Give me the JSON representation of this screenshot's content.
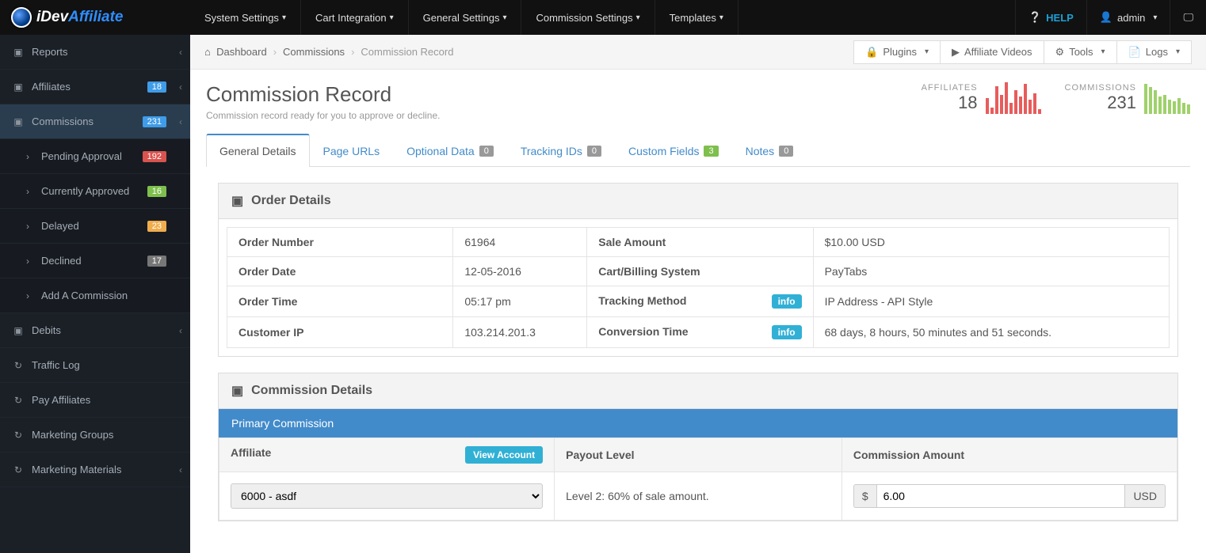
{
  "brand": {
    "name1": "iDev",
    "name2": "Affiliate"
  },
  "topnav": [
    "System Settings",
    "Cart Integration",
    "General Settings",
    "Commission Settings",
    "Templates"
  ],
  "topright": {
    "help": "HELP",
    "user": "admin"
  },
  "sidebar": {
    "main": [
      {
        "label": "Reports",
        "icon": "▣",
        "arrow": "‹"
      },
      {
        "label": "Affiliates",
        "icon": "▣",
        "badge": "18",
        "bclass": "b-blue",
        "arrow": "‹"
      },
      {
        "label": "Commissions",
        "icon": "▣",
        "badge": "231",
        "bclass": "b-blue",
        "arrow": "‹",
        "active": true
      }
    ],
    "subs": [
      {
        "label": "Pending Approval",
        "badge": "192",
        "bclass": "b-red"
      },
      {
        "label": "Currently Approved",
        "badge": "16",
        "bclass": "b-green"
      },
      {
        "label": "Delayed",
        "badge": "23",
        "bclass": "b-orange"
      },
      {
        "label": "Declined",
        "badge": "17",
        "bclass": "b-grey"
      },
      {
        "label": "Add A Commission"
      }
    ],
    "rest": [
      {
        "label": "Debits",
        "icon": "▣",
        "arrow": "‹"
      },
      {
        "label": "Traffic Log",
        "icon": "↻"
      },
      {
        "label": "Pay Affiliates",
        "icon": "↻"
      },
      {
        "label": "Marketing Groups",
        "icon": "↻"
      },
      {
        "label": "Marketing Materials",
        "icon": "↻",
        "arrow": "‹"
      }
    ]
  },
  "breadcrumb": {
    "items": [
      "Dashboard",
      "Commissions",
      "Commission Record"
    ]
  },
  "topbuttons": {
    "plugins": "Plugins",
    "videos": "Affiliate Videos",
    "tools": "Tools",
    "logs": "Logs"
  },
  "page": {
    "title": "Commission Record",
    "subtitle": "Commission record ready for you to approve or decline."
  },
  "metrics": {
    "affiliates": {
      "label": "AFFILIATES",
      "value": "18",
      "bars": [
        20,
        8,
        35,
        24,
        40,
        14,
        30,
        22,
        38,
        18,
        26,
        6
      ]
    },
    "commissions": {
      "label": "COMMISSIONS",
      "value": "231",
      "bars": [
        38,
        34,
        30,
        22,
        24,
        18,
        16,
        20,
        14,
        12
      ]
    }
  },
  "tabs": [
    {
      "label": "General Details",
      "active": true
    },
    {
      "label": "Page URLs"
    },
    {
      "label": "Optional Data",
      "badge": "0"
    },
    {
      "label": "Tracking IDs",
      "badge": "0"
    },
    {
      "label": "Custom Fields",
      "badge": "3",
      "g": true
    },
    {
      "label": "Notes",
      "badge": "0"
    }
  ],
  "order": {
    "title": "Order Details",
    "rows": [
      {
        "l1": "Order Number",
        "v1": "61964",
        "l2": "Sale Amount",
        "v2": "$10.00 USD"
      },
      {
        "l1": "Order Date",
        "v1": "12-05-2016",
        "l2": "Cart/Billing System",
        "v2": "PayTabs"
      },
      {
        "l1": "Order Time",
        "v1": "05:17 pm",
        "l2": "Tracking Method",
        "v2": "IP Address - API Style",
        "info": true
      },
      {
        "l1": "Customer IP",
        "v1": "103.214.201.3",
        "l2": "Conversion Time",
        "v2": "68 days, 8 hours, 50 minutes and 51 seconds.",
        "info": true
      }
    ]
  },
  "commission": {
    "title": "Commission Details",
    "primary_label": "Primary Commission",
    "cols": {
      "affiliate": "Affiliate",
      "payout": "Payout Level",
      "amount": "Commission Amount"
    },
    "view_account": "View Account",
    "affiliate_value": "6000 - asdf",
    "payout_value": "Level 2: 60% of sale amount.",
    "amount_prefix": "$",
    "amount_value": "6.00",
    "amount_suffix": "USD",
    "info_label": "info"
  }
}
